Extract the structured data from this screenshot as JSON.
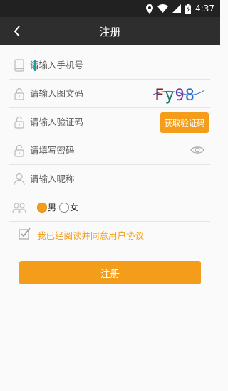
{
  "status_bar": {
    "time": "4:37"
  },
  "app_bar": {
    "title": "注册"
  },
  "form": {
    "phone": {
      "placeholder": "请输入手机号"
    },
    "captcha": {
      "placeholder": "请输入图文码",
      "image_text": "Fy98"
    },
    "verify_code": {
      "placeholder": "请输入验证码",
      "button_label": "获取验证码"
    },
    "password": {
      "placeholder": "请填写密码"
    },
    "nickname": {
      "placeholder": "请输入昵称"
    },
    "gender": {
      "male_label": "男",
      "female_label": "女",
      "selected": "男"
    }
  },
  "agreement": {
    "label": "我已经阅读并同意用户协议",
    "checked": true
  },
  "submit": {
    "label": "注册"
  },
  "colors": {
    "accent": "#f49d1a",
    "app_bar": "#2e2e2e",
    "status_bar": "#212121"
  }
}
